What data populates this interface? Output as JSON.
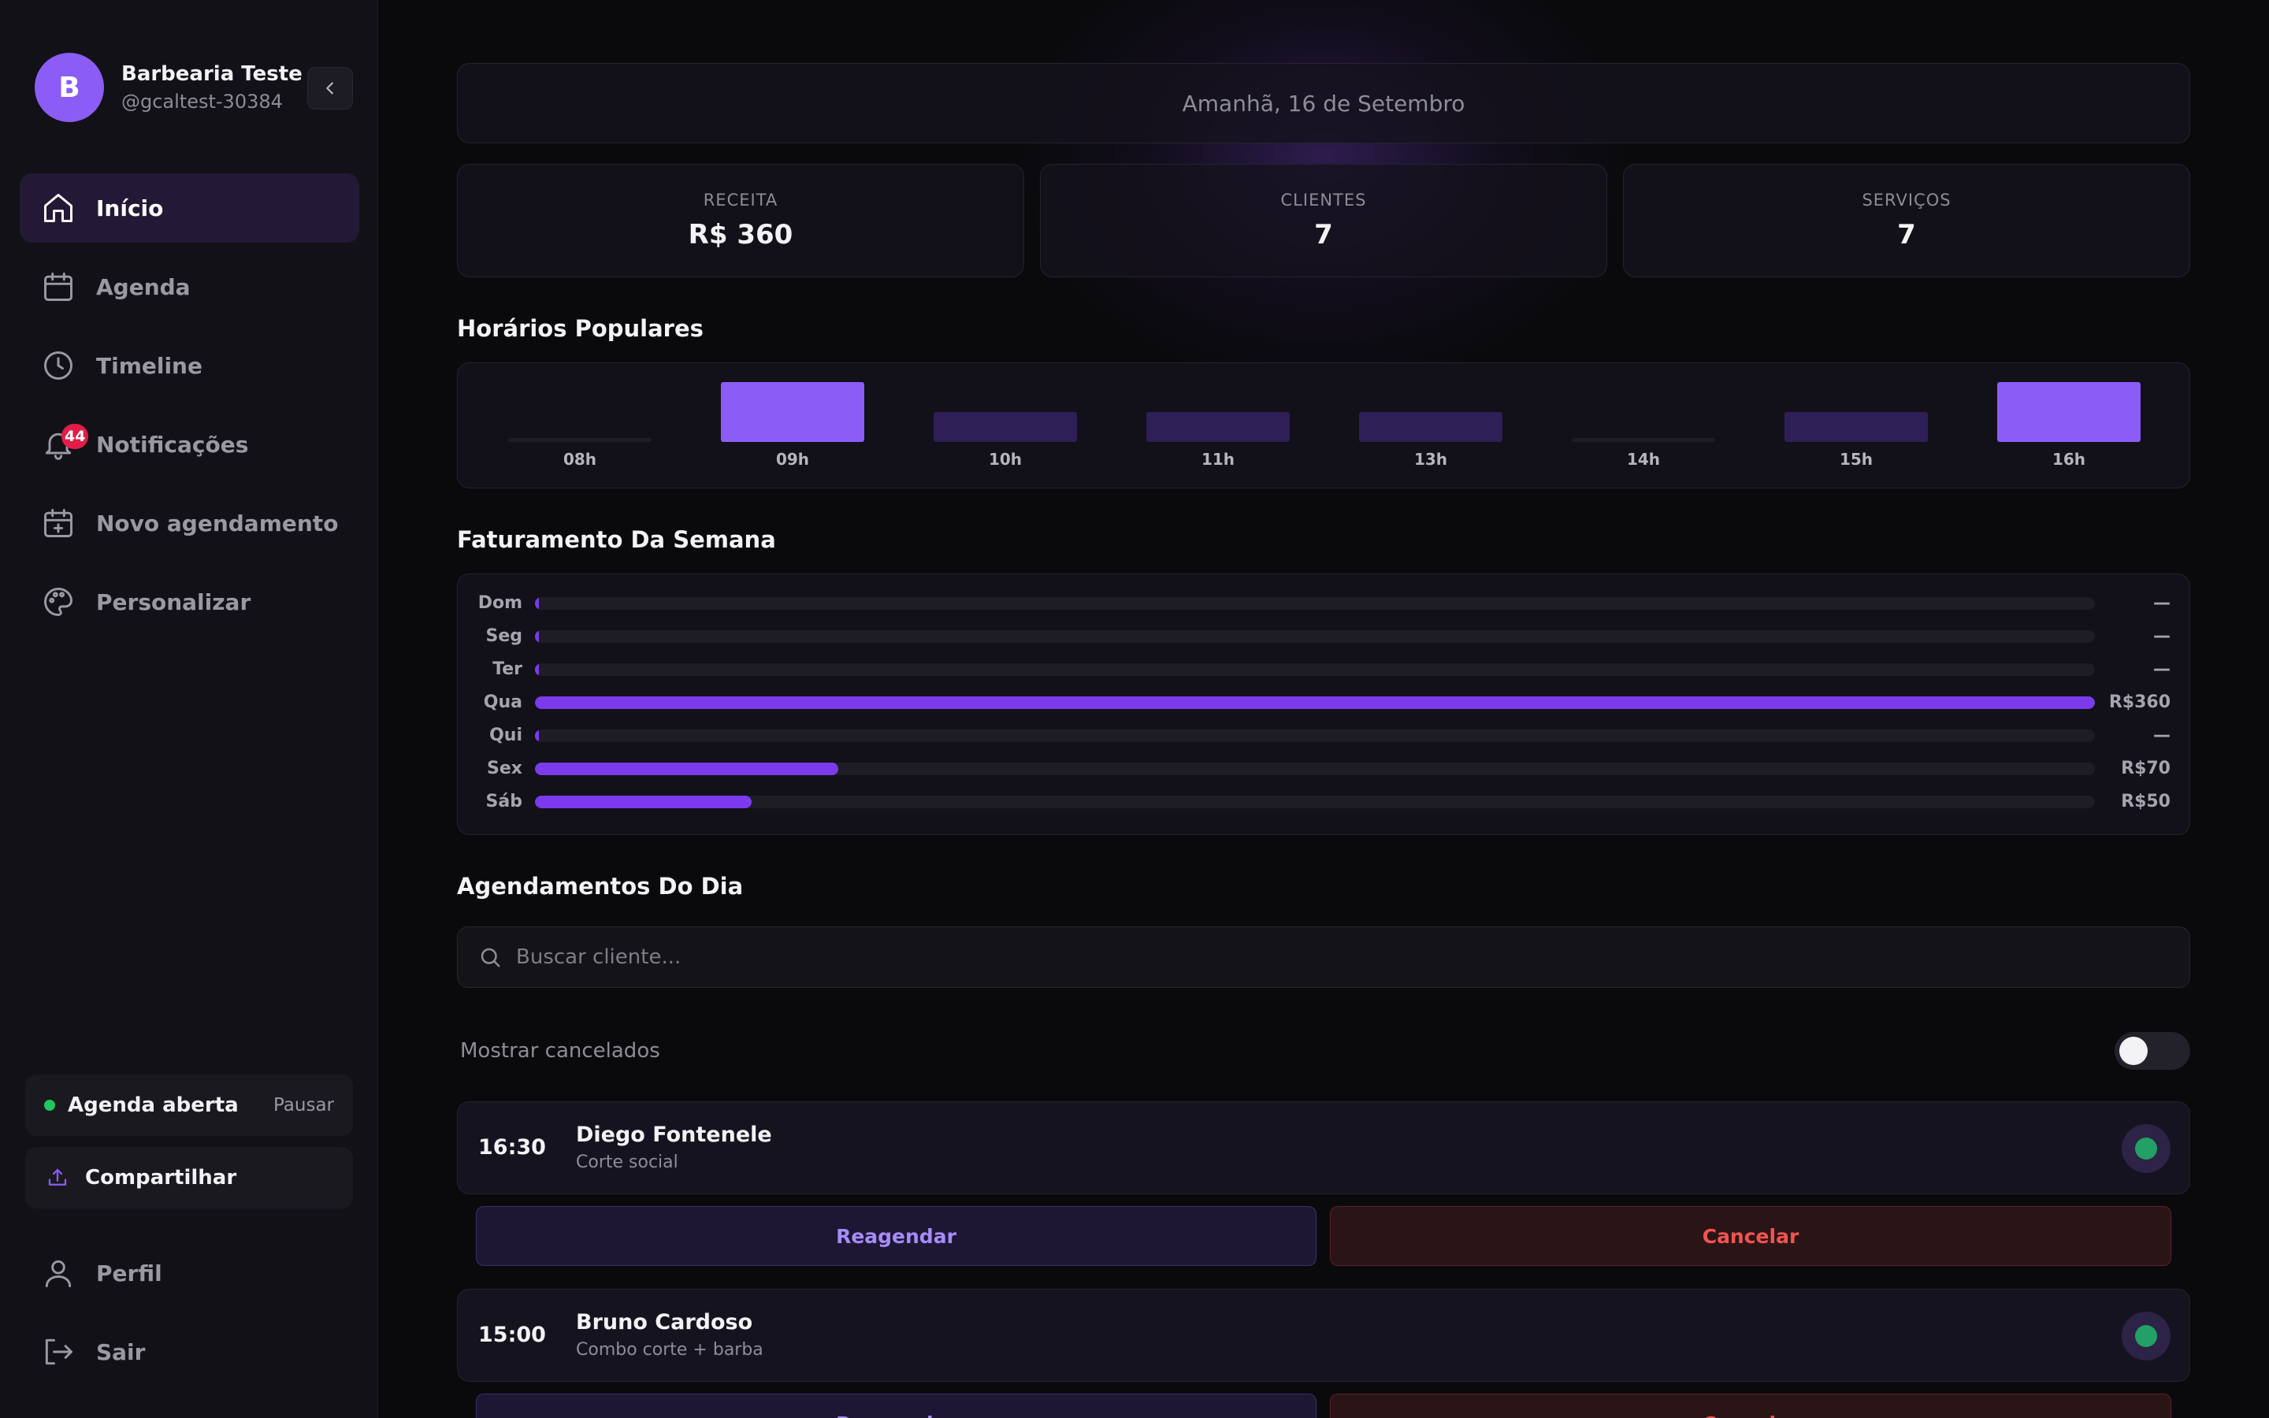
{
  "profile": {
    "initial": "B",
    "name": "Barbearia Teste",
    "handle": "@gcaltest-30384"
  },
  "nav": {
    "items": [
      {
        "label": "Início",
        "icon": "home-icon"
      },
      {
        "label": "Agenda",
        "icon": "calendar-icon"
      },
      {
        "label": "Timeline",
        "icon": "clock-icon"
      },
      {
        "label": "Notificações",
        "icon": "bell-icon",
        "badge": "44"
      },
      {
        "label": "Novo agendamento",
        "icon": "calendar-plus-icon"
      },
      {
        "label": "Personalizar",
        "icon": "palette-icon"
      }
    ],
    "active": "Início"
  },
  "agenda_status": {
    "label": "Agenda aberta",
    "action": "Pausar"
  },
  "share": {
    "label": "Compartilhar"
  },
  "bottom_nav": {
    "profile": "Perfil",
    "logout": "Sair"
  },
  "header": {
    "date": "Amanhã, 16 de Setembro"
  },
  "stats": [
    {
      "label": "RECEITA",
      "value": "R$ 360"
    },
    {
      "label": "CLIENTES",
      "value": "7"
    },
    {
      "label": "SERVIÇOS",
      "value": "7"
    }
  ],
  "popular_hours": {
    "title": "Horários Populares",
    "chart_data": {
      "type": "bar",
      "categories": [
        "08h",
        "09h",
        "10h",
        "11h",
        "13h",
        "14h",
        "15h",
        "16h"
      ],
      "values": [
        0,
        2,
        1,
        1,
        1,
        0,
        1,
        2
      ],
      "ylim": [
        0,
        2
      ]
    }
  },
  "weekly_revenue": {
    "title": "Faturamento Da Semana",
    "chart_data": {
      "type": "bar",
      "orientation": "horizontal",
      "categories": [
        "Dom",
        "Seg",
        "Ter",
        "Qua",
        "Qui",
        "Sex",
        "Sáb"
      ],
      "values": [
        0,
        0,
        0,
        360,
        0,
        70,
        50
      ],
      "labels": [
        "—",
        "—",
        "—",
        "R$360",
        "—",
        "R$70",
        "R$50"
      ],
      "xlim": [
        0,
        360
      ]
    }
  },
  "appointments": {
    "title": "Agendamentos Do Dia",
    "search_placeholder": "Buscar cliente...",
    "show_cancelled_label": "Mostrar cancelados",
    "show_cancelled": false,
    "items": [
      {
        "time": "16:30",
        "client": "Diego Fontenele",
        "service": "Corte social",
        "reschedule": "Reagendar",
        "cancel": "Cancelar"
      },
      {
        "time": "15:00",
        "client": "Bruno Cardoso",
        "service": "Combo corte + barba",
        "reschedule": "Reagendar",
        "cancel": "Cancelar"
      }
    ]
  },
  "colors": {
    "accent": "#8b5cf6",
    "accent_dark": "#7c3aed",
    "bar_dim": "#2e1f57",
    "success": "#22c55e",
    "danger": "#f2544f",
    "badge": "#e11d48"
  }
}
